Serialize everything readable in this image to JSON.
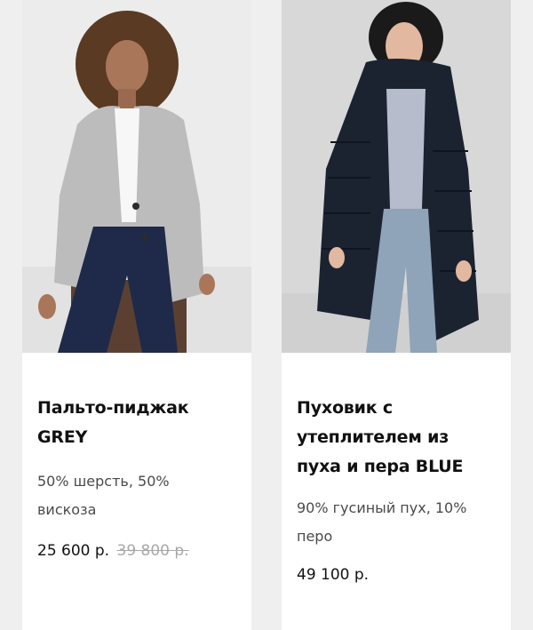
{
  "products": [
    {
      "title": "Пальто-пиджак GREY",
      "composition": "50% шерсть, 50% вискоза",
      "price": "25 600 р.",
      "old_price": "39 800 р.",
      "image_subject": "woman in grey wool blazer and dark jeans",
      "colors": {
        "background": "#e9e9e9",
        "garment": "#bdbdbd"
      }
    },
    {
      "title": "Пуховик с утеплителем из пуха и пера BLUE",
      "composition": "90% гусиный пух, 10% перо",
      "price": "49 100 р.",
      "image_subject": "woman in long navy down puffer coat and light jeans",
      "colors": {
        "background": "#d6d6d6",
        "garment": "#1c2533"
      }
    }
  ]
}
